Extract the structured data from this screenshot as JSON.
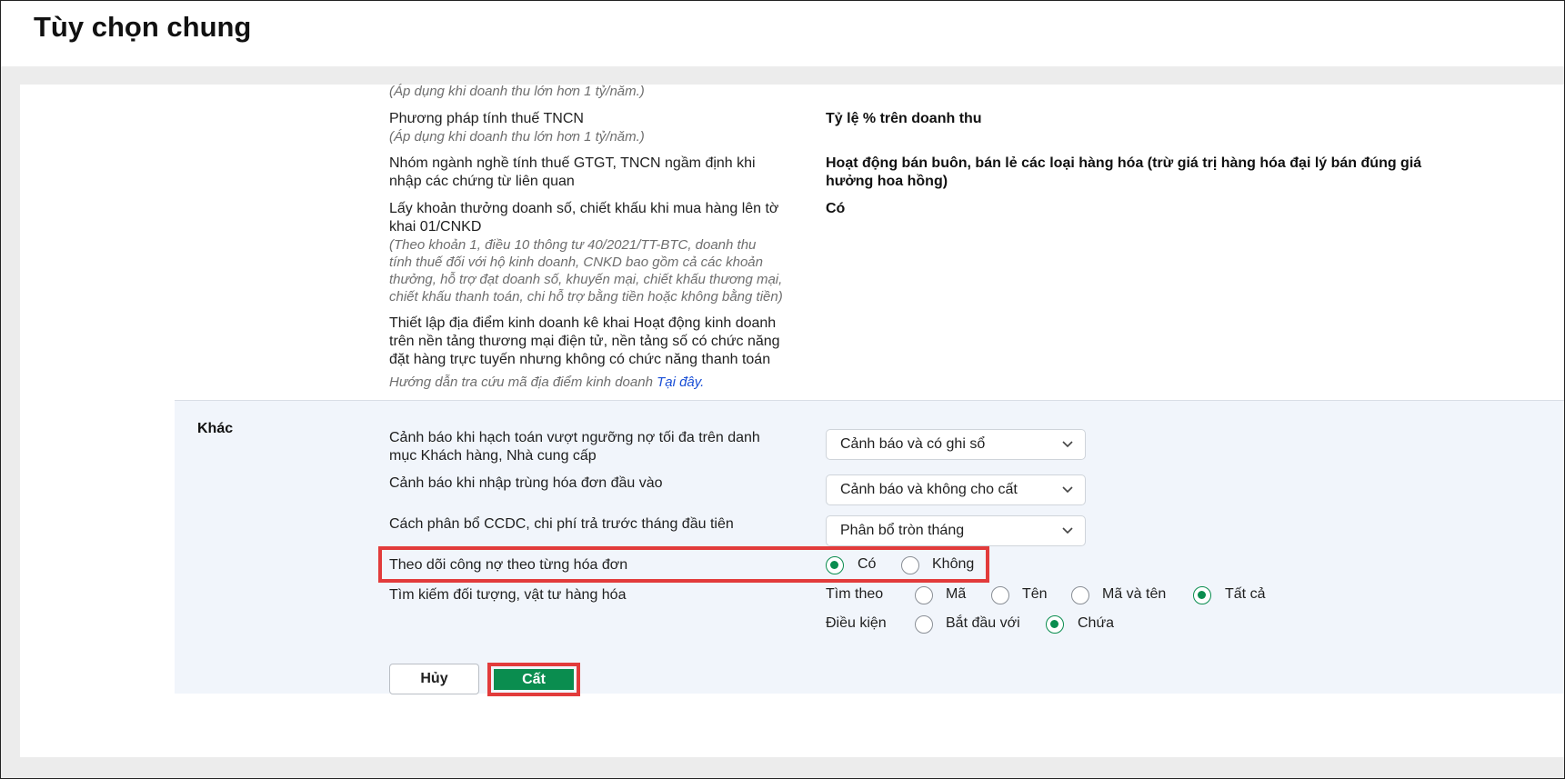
{
  "page": {
    "title": "Tùy chọn chung"
  },
  "tax": {
    "hint_top": "(Áp dụng khi doanh thu lớn hơn 1 tỷ/năm.)",
    "pit_method_label": "Phương pháp tính thuế TNCN",
    "pit_method_hint": "(Áp dụng khi doanh thu lớn hơn 1 tỷ/năm.)",
    "pit_method_value": "Tỷ lệ % trên doanh thu",
    "industry_label_1": "Nhóm ngành nghề tính thuế GTGT, TNCN ngầm định khi",
    "industry_label_2": "nhập các chứng từ liên quan",
    "industry_value_1": "Hoạt động bán buôn, bán lẻ các loại hàng hóa (trừ giá trị hàng hóa đại lý bán đúng giá",
    "industry_value_2": "hưởng hoa hồng)",
    "bonus_label_1": "Lấy khoản thưởng doanh số, chiết khấu khi mua hàng lên tờ",
    "bonus_label_2": "khai 01/CNKD",
    "bonus_hint_1": "(Theo khoản 1, điều 10 thông tư 40/2021/TT-BTC, doanh thu",
    "bonus_hint_2": "tính thuế đối với hộ kinh doanh, CNKD bao gồm cả các khoản",
    "bonus_hint_3": "thưởng, hỗ trợ đạt doanh số, khuyến mại, chiết khấu thương mại,",
    "bonus_hint_4": "chiết khấu thanh toán, chi hỗ trợ bằng tiền hoặc không bằng tiền)",
    "bonus_value": "Có",
    "location_label_1": "Thiết lập địa điểm kinh doanh kê khai Hoạt động kinh doanh",
    "location_label_2": "trên nền tảng thương mại điện tử, nền tảng số có chức năng",
    "location_label_3": "đặt hàng trực tuyến nhưng không có chức năng thanh toán",
    "location_hint": "Hướng dẫn tra cứu mã địa điểm kinh doanh ",
    "location_link": "Tại đây."
  },
  "other": {
    "section_title": "Khác",
    "debt_warning_label_1": "Cảnh báo khi hạch toán vượt ngưỡng nợ tối đa trên danh",
    "debt_warning_label_2": "mục Khách hàng, Nhà cung cấp",
    "debt_warning_value": "Cảnh báo và có ghi sổ",
    "dup_invoice_label": "Cảnh báo khi nhập trùng hóa đơn đầu vào",
    "dup_invoice_value": "Cảnh báo và không cho cất",
    "ccdc_label": "Cách phân bổ CCDC, chi phí trả trước tháng đầu tiên",
    "ccdc_value": "Phân bổ tròn tháng",
    "track_debt_label": "Theo dõi công nợ theo từng hóa đơn",
    "track_debt_options": [
      "Có",
      "Không"
    ],
    "track_debt_selected": "Có",
    "search_label": "Tìm kiếm đối tượng, vật tư hàng hóa",
    "search_by_label": "Tìm theo",
    "search_by_options": [
      "Mã",
      "Tên",
      "Mã và tên",
      "Tất cả"
    ],
    "search_by_selected": "Tất cả",
    "condition_label": "Điều kiện",
    "condition_options": [
      "Bắt đầu với",
      "Chứa"
    ],
    "condition_selected": "Chứa"
  },
  "actions": {
    "cancel": "Hủy",
    "save": "Cất"
  },
  "colors": {
    "accent": "#0a8d4f",
    "highlight": "#e23b3b",
    "section_bg": "#f1f5fb"
  }
}
